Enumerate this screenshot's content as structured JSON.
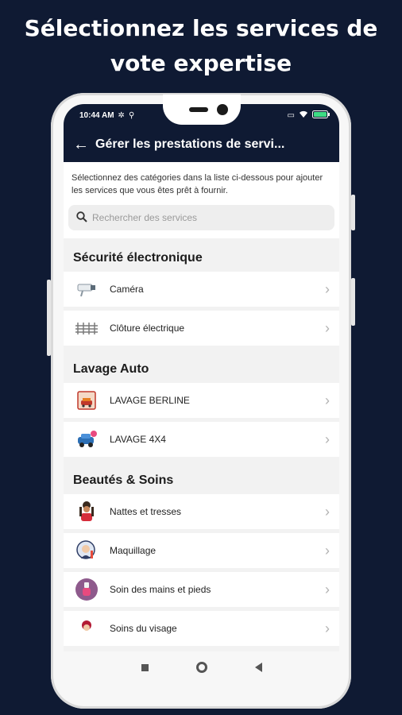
{
  "headline": {
    "line1": "Sélectionnez les services de",
    "line2": "vote expertise"
  },
  "statusbar": {
    "time": "10:44 AM"
  },
  "appbar": {
    "title": "Gérer les prestations de servi..."
  },
  "intro": "Sélectionnez des catégories dans la liste ci-dessous pour ajouter les services que vous êtes prêt à fournir.",
  "search": {
    "placeholder": "Rechercher des services"
  },
  "sections": [
    {
      "title": "Sécurité électronique",
      "items": [
        {
          "label": "Caméra",
          "icon": "camera-icon"
        },
        {
          "label": "Clôture électrique",
          "icon": "fence-icon"
        }
      ]
    },
    {
      "title": "Lavage Auto",
      "items": [
        {
          "label": "LAVAGE BERLINE",
          "icon": "car-wash-icon"
        },
        {
          "label": "LAVAGE 4X4",
          "icon": "suv-icon"
        }
      ]
    },
    {
      "title": "Beautés & Soins",
      "items": [
        {
          "label": "Nattes et tresses",
          "icon": "braids-icon"
        },
        {
          "label": "Maquillage",
          "icon": "makeup-icon"
        },
        {
          "label": "Soin des mains et pieds",
          "icon": "nail-polish-icon"
        },
        {
          "label": "Soins du visage",
          "icon": "face-care-icon"
        }
      ]
    }
  ]
}
